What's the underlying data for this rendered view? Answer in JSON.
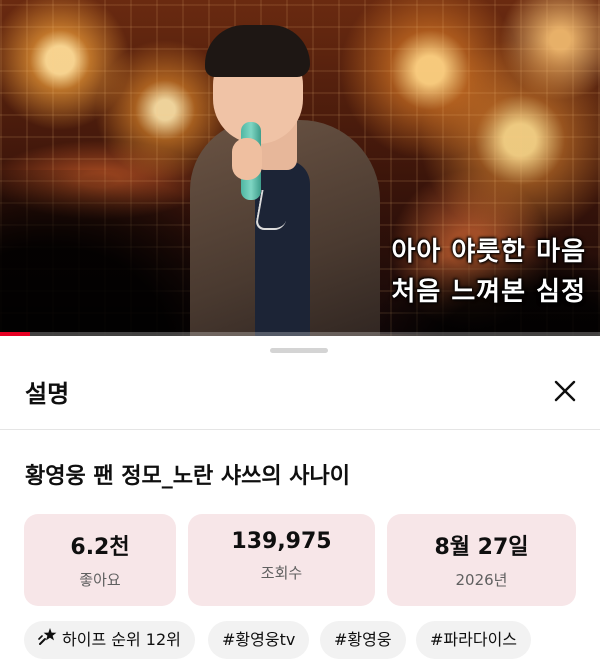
{
  "video": {
    "lyrics_line1": "아아 야릇한 마음",
    "lyrics_line2": "처음 느껴본 심정",
    "progress_fraction": 0.05,
    "accent_color": "#e60023"
  },
  "sheet": {
    "title": "설명",
    "close_icon": "close-icon",
    "video_title": "황영웅 팬 정모_노란 샤쓰의 사나이",
    "stats": [
      {
        "value": "6.2천",
        "label": "좋아요"
      },
      {
        "value": "139,975",
        "label": "조회수"
      },
      {
        "value": "8월 27일",
        "label": "2026년"
      }
    ],
    "chips": [
      {
        "icon": "trending-star-icon",
        "label": "하이프 순위 12위"
      },
      {
        "label": "#황영웅tv"
      },
      {
        "label": "#황영웅"
      },
      {
        "label": "#파라다이스"
      }
    ]
  }
}
